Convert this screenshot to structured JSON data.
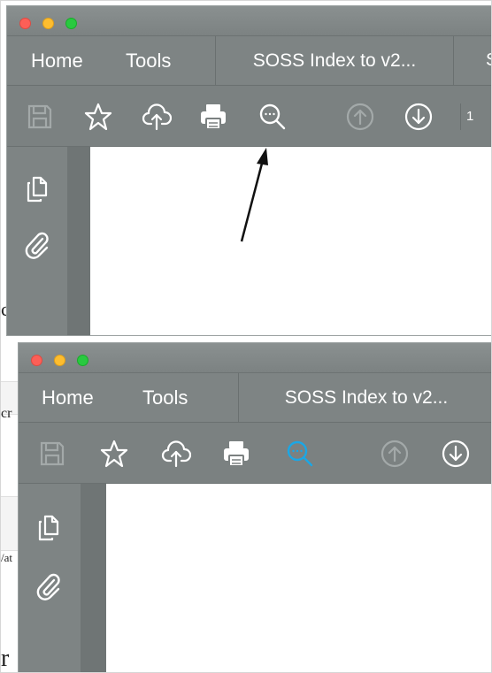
{
  "screens": [
    {
      "nav": {
        "home_label": "Home",
        "tools_label": "Tools"
      },
      "document_tab": {
        "title": "SOSS Index to v2..."
      },
      "next_tab_fragment": "S",
      "page_field": {
        "value": "1"
      },
      "search_icon_state": "normal",
      "search_icon_color": "#ffffff"
    },
    {
      "nav": {
        "home_label": "Home",
        "tools_label": "Tools"
      },
      "document_tab": {
        "title": "SOSS Index to v2..."
      },
      "search_icon_state": "active",
      "search_icon_color": "#1aa7e6"
    }
  ],
  "background_fragments": {
    "a": "c",
    "b": "cr",
    "c": "/at",
    "d": "r"
  },
  "toolbar_icons": [
    "save-icon",
    "star-icon",
    "cloud-upload-icon",
    "print-icon",
    "search-icon",
    "arrow-up-icon",
    "arrow-down-icon"
  ],
  "sidebar_icons": [
    "pages-icon",
    "attachment-icon"
  ],
  "colors": {
    "chrome": "#7b8181",
    "icon": "#ffffff",
    "icon_disabled": "#a3a9a9",
    "active_search": "#1aa7e6"
  }
}
